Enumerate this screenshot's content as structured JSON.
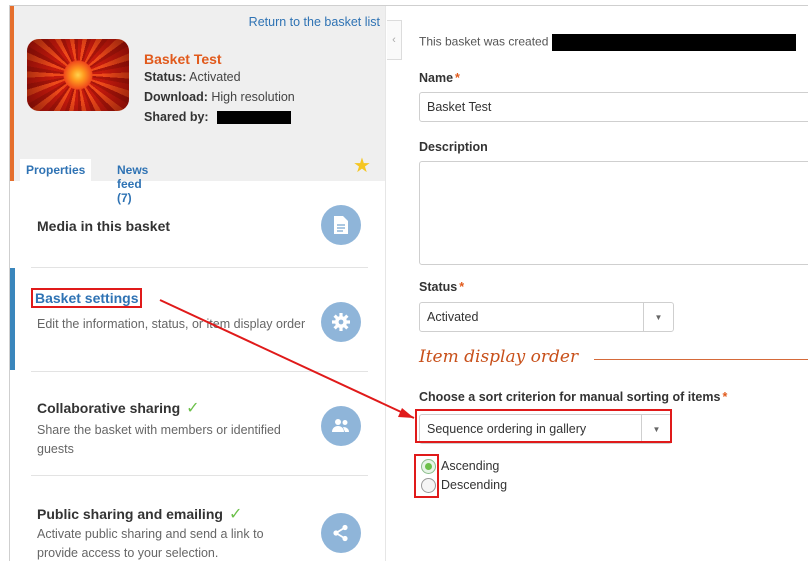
{
  "header": {
    "return_link": "Return to the basket list",
    "basket_title": "Basket Test",
    "status_label": "Status:",
    "status_value": "Activated",
    "download_label": "Download:",
    "download_value": "High resolution",
    "shared_label": "Shared by:"
  },
  "tabs": [
    {
      "label": "Properties"
    },
    {
      "label": "News feed (7)"
    }
  ],
  "sections": [
    {
      "title": "Media in this basket",
      "description": "",
      "icon": "document-icon"
    },
    {
      "title": "Basket settings",
      "description": "Edit the information, status, or item display order",
      "icon": "gear-icon"
    },
    {
      "title": "Collaborative sharing",
      "description": "Share the basket with members or identified guests",
      "icon": "people-icon"
    },
    {
      "title": "Public sharing and emailing",
      "description": "Activate public sharing and send a link to provide access to your selection.",
      "icon": "share-icon"
    }
  ],
  "form": {
    "created_text": "This basket was created",
    "name_label": "Name",
    "name_value": "Basket Test",
    "description_label": "Description",
    "description_value": "",
    "status_label": "Status",
    "status_value": "Activated",
    "order_heading": "Item display order",
    "sort_label": "Choose a sort criterion for manual sorting of items",
    "sort_value": "Sequence ordering in gallery",
    "ascending_label": "Ascending",
    "descending_label": "Descending",
    "required_mark": "*",
    "selected_order": "Ascending"
  },
  "colors": {
    "accent_orange": "#e15a1c",
    "link_blue": "#2f73b4",
    "icon_circle": "#8fb5d9",
    "annotation_red": "#e01a1a",
    "check_green": "#6cc04a"
  }
}
